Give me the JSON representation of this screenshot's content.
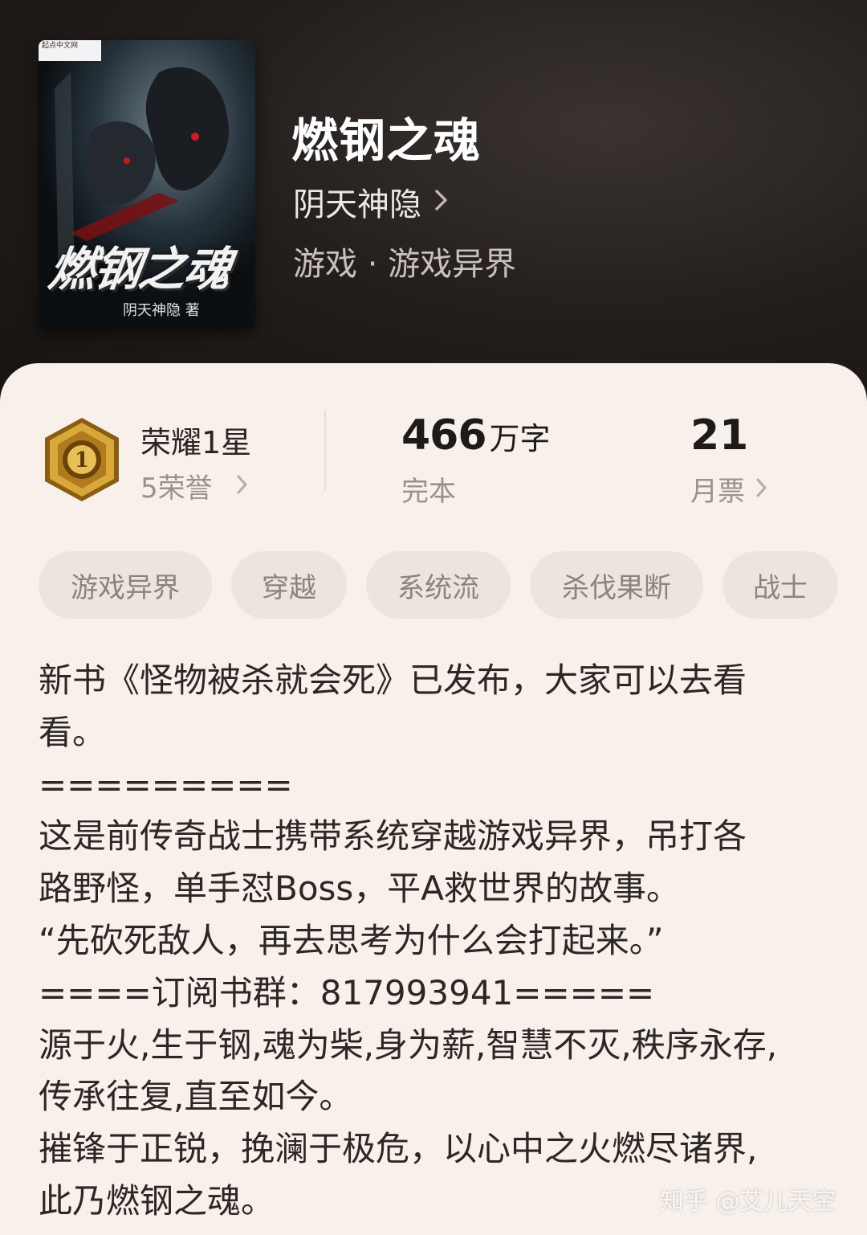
{
  "book": {
    "title": "燃钢之魂",
    "author": "阴天神隐",
    "genre": "游戏 · 游戏异界",
    "cover": {
      "title": "燃钢之魂",
      "author_line": "阴天神隐 著",
      "badge": "起点中文网"
    }
  },
  "honor": {
    "title": "荣耀1星",
    "sub": "5荣誉",
    "icon": "medal-1-icon"
  },
  "stats": {
    "words_value": "466",
    "words_unit": "万字",
    "status": "完本",
    "votes_value": "21",
    "votes_label": "月票"
  },
  "tags": [
    "游戏异界",
    "穿越",
    "系统流",
    "杀伐果断",
    "战士"
  ],
  "description": [
    "新书《怪物被杀就会死》已发布，大家可以去看",
    "看。",
    "=========",
    "这是前传奇战士携带系统穿越游戏异界，吊打各",
    "路野怪，单手怼Boss，平A救世界的故事。",
    "“先砍死敌人，再去思考为什么会打起来。”",
    "====订阅书群：817993941=====",
    "源于火,生于钢,魂为柴,身为薪,智慧不灭,秩序永存,",
    "传承往复,直至如今。",
    "摧锋于正锐，挽澜于极危，以心中之火燃尽诸界,",
    "此乃燃钢之魂。"
  ],
  "watermark": "知乎 @艾儿天空",
  "colors": {
    "hero_bg": "#1f1b19",
    "sheet_bg": "#f7f0eb",
    "tag_bg": "#ede4de",
    "medal_gold": "#c9962a"
  }
}
